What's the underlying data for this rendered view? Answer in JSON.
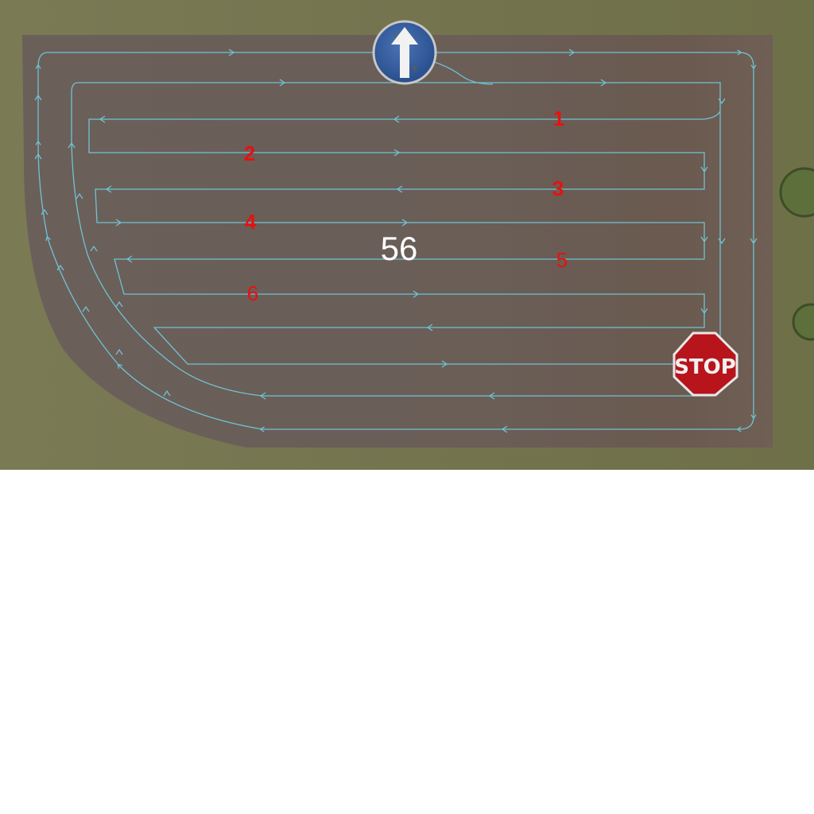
{
  "map": {
    "field_number": "56",
    "lane_labels": [
      {
        "id": "lane-1",
        "text": "1"
      },
      {
        "id": "lane-2",
        "text": "2"
      },
      {
        "id": "lane-3",
        "text": "3"
      },
      {
        "id": "lane-4",
        "text": "4"
      },
      {
        "id": "lane-5",
        "text": "5"
      },
      {
        "id": "lane-6",
        "text": "6"
      }
    ],
    "start_sign": {
      "icon": "arrow-up-icon"
    },
    "stop_sign": {
      "text": "STOP",
      "icon": "stop-sign-icon"
    },
    "colors": {
      "grass": "#77774f",
      "field": "#6a5e57",
      "path": "#6fc3d3",
      "label": "#e8100f",
      "start_sign": "#2f5a9e",
      "stop_sign": "#b8141c",
      "tree": "#5c6e3a"
    }
  }
}
